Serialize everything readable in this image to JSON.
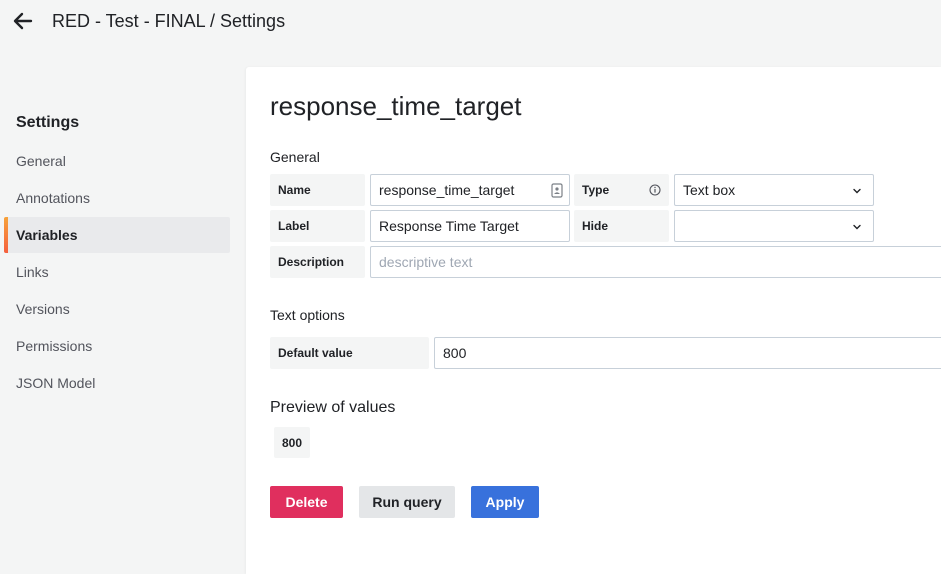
{
  "header": {
    "breadcrumb": "RED - Test - FINAL / Settings",
    "back_icon": "arrow-left-icon"
  },
  "sidebar": {
    "title": "Settings",
    "items": [
      {
        "label": "General",
        "active": false
      },
      {
        "label": "Annotations",
        "active": false
      },
      {
        "label": "Variables",
        "active": true
      },
      {
        "label": "Links",
        "active": false
      },
      {
        "label": "Versions",
        "active": false
      },
      {
        "label": "Permissions",
        "active": false
      },
      {
        "label": "JSON Model",
        "active": false
      }
    ]
  },
  "editor": {
    "variable_title": "response_time_target",
    "general_section": "General",
    "name_label": "Name",
    "name_value": "response_time_target",
    "type_label": "Type",
    "type_value": "Text box",
    "label_label": "Label",
    "label_value": "Response Time Target",
    "hide_label": "Hide",
    "hide_value": "",
    "description_label": "Description",
    "description_placeholder": "descriptive text",
    "text_options_section": "Text options",
    "default_value_label": "Default value",
    "default_value": "800",
    "preview_title": "Preview of values",
    "preview_values": [
      "800"
    ]
  },
  "actions": {
    "delete_label": "Delete",
    "run_query_label": "Run query",
    "apply_label": "Apply"
  },
  "colors": {
    "accent_active": "#f55f3e",
    "delete": "#e02f5e",
    "apply": "#3871dc"
  }
}
